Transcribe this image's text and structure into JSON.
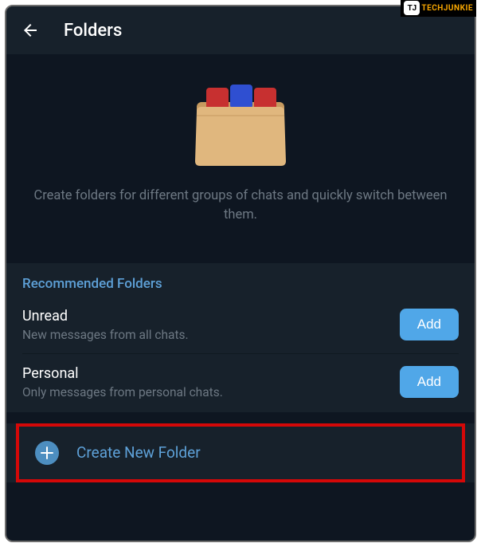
{
  "watermark": {
    "logo": "TJ",
    "text": "TECHJUNKIE"
  },
  "header": {
    "title": "Folders"
  },
  "intro": {
    "text": "Create folders for different groups of chats and quickly switch between them."
  },
  "recommended": {
    "title": "Recommended Folders",
    "items": [
      {
        "name": "Unread",
        "desc": "New messages from all chats.",
        "button": "Add"
      },
      {
        "name": "Personal",
        "desc": "Only messages from personal chats.",
        "button": "Add"
      }
    ]
  },
  "create": {
    "label": "Create New Folder"
  }
}
